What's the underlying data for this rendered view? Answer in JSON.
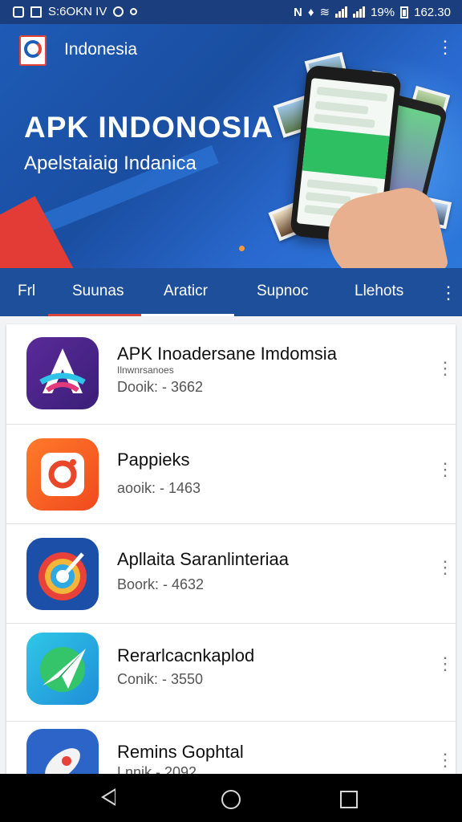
{
  "status_bar": {
    "left_text": "S:6OKN IV",
    "battery": "19%",
    "time": "162.30"
  },
  "hero": {
    "brand": "Indonesia",
    "title": "APK INDONOSIA",
    "subtitle": "Apelstaiaig Indanica",
    "more_icon": "⋮"
  },
  "tabs": {
    "items": [
      {
        "label": "Frl",
        "selected": false
      },
      {
        "label": "Suunas",
        "selected": false
      },
      {
        "label": "Araticr",
        "selected": true
      },
      {
        "label": "Supnoc",
        "selected": false
      },
      {
        "label": "Llehots",
        "selected": false
      }
    ],
    "more_icon": "⋮",
    "indicator_colors": [
      "#d9443c",
      "#ffffff"
    ]
  },
  "apps": [
    {
      "name": "APK Inoadersane Imdomsia",
      "sub": "Ilnwnrsanoes",
      "meta": "Dooik: - 3662",
      "icon": "a-logo-icon"
    },
    {
      "name": "Pappieks",
      "sub": "",
      "meta": "aooik: - 1463",
      "icon": "camera-ring-icon"
    },
    {
      "name": "Apllaita Saranlinteriaa",
      "sub": "",
      "meta": "Boork: - 4632",
      "icon": "target-arrow-icon"
    },
    {
      "name": "Rerarlcacnkaplod",
      "sub": "",
      "meta": "Conik: - 3550",
      "icon": "paper-plane-icon"
    },
    {
      "name": "Remins Gophtal",
      "sub": "",
      "meta": "Lnnik - 2092",
      "icon": "rocket-icon"
    }
  ],
  "item_more_icon": "⋮"
}
